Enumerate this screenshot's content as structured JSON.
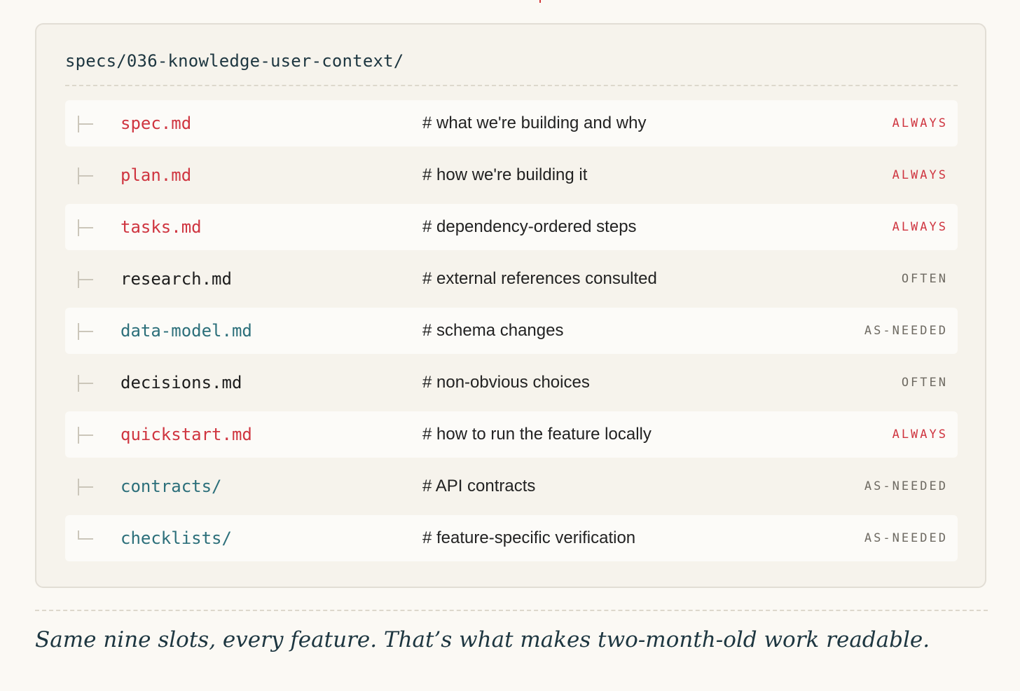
{
  "figure": {
    "root_path": "specs/036-knowledge-user-context/",
    "caption": "Same nine slots, every feature. That’s what makes two-month-old work readable.",
    "colors": {
      "background": "#fbf9f4",
      "card": "#f6f3ec",
      "core_file": "#cf3540",
      "plain_file": "#1c1c1c",
      "teal_file": "#2c6f7a",
      "muted_tag": "#6e6a62",
      "caption": "#1d3640"
    },
    "entries": [
      {
        "name": "spec.md",
        "description": "# what we're building and why",
        "frequency": "ALWAYS"
      },
      {
        "name": "plan.md",
        "description": "# how we're building it",
        "frequency": "ALWAYS"
      },
      {
        "name": "tasks.md",
        "description": "# dependency-ordered steps",
        "frequency": "ALWAYS"
      },
      {
        "name": "research.md",
        "description": "# external references consulted",
        "frequency": "OFTEN"
      },
      {
        "name": "data-model.md",
        "description": "# schema changes",
        "frequency": "AS-NEEDED"
      },
      {
        "name": "decisions.md",
        "description": "# non-obvious choices",
        "frequency": "OFTEN"
      },
      {
        "name": "quickstart.md",
        "description": "# how to run the feature locally",
        "frequency": "ALWAYS"
      },
      {
        "name": "contracts/",
        "description": "# API contracts",
        "frequency": "AS-NEEDED"
      },
      {
        "name": "checklists/",
        "description": "# feature-specific verification",
        "frequency": "AS-NEEDED"
      }
    ]
  }
}
